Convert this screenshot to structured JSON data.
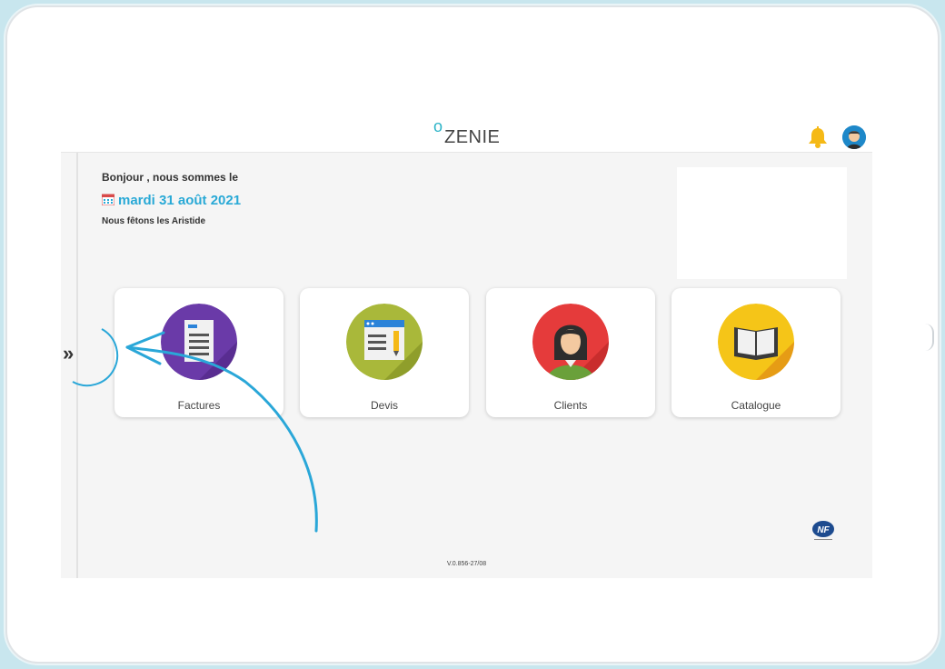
{
  "app": {
    "logo_text": "ZENIE",
    "logo_mark": "õ"
  },
  "header": {
    "icons": [
      "bell-icon",
      "user-avatar"
    ],
    "accent": "#29a9d6",
    "bell_color": "#f5b916"
  },
  "greeting": {
    "line1": "Bonjour , nous sommes le",
    "date": "mardi 31 août 2021",
    "fete": "Nous fêtons les Aristide"
  },
  "tiles": [
    {
      "label": "Factures",
      "icon": "invoice-icon",
      "color": "#6a3aa8"
    },
    {
      "label": "Devis",
      "icon": "quote-icon",
      "color": "#a9b83a"
    },
    {
      "label": "Clients",
      "icon": "client-icon",
      "color": "#e53b3b"
    },
    {
      "label": "Catalogue",
      "icon": "catalogue-icon",
      "color": "#f5c518"
    }
  ],
  "footer": {
    "version": "V.0.856-27/08",
    "cert_badge": "NF"
  },
  "sidebar_toggle": {
    "glyph": "»"
  }
}
